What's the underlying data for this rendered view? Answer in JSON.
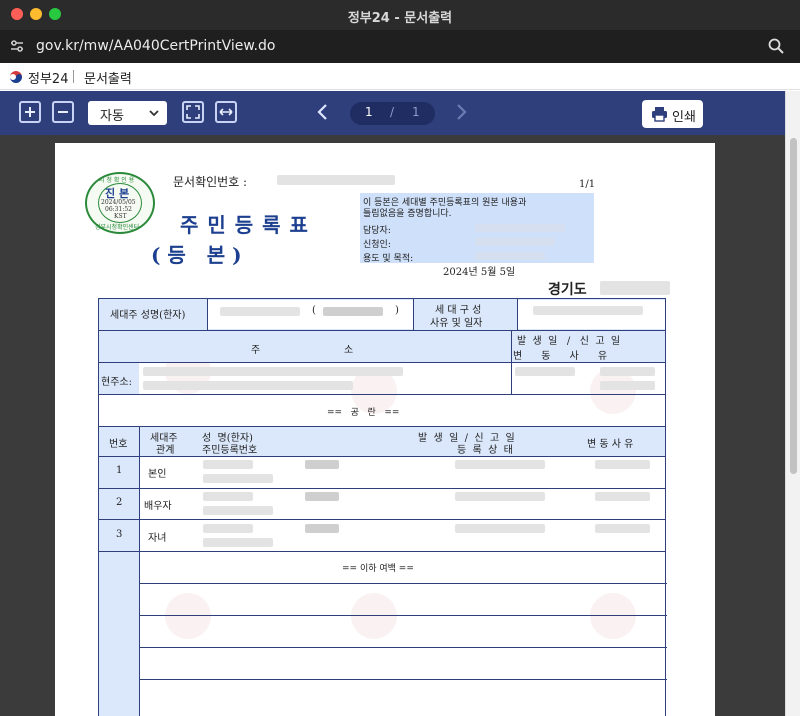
{
  "window": {
    "title": "정부24 - 문서출력"
  },
  "browser": {
    "url": "gov.kr/mw/AA040CertPrintView.do"
  },
  "site": {
    "name": "정부24",
    "page": "문서출력"
  },
  "toolbar": {
    "zoom_value": "자동",
    "page_current": "1",
    "page_separator": "/",
    "page_total": "1",
    "print_label": "인쇄"
  },
  "document": {
    "doc_number_label": "문서확인번호 :",
    "page_label": "1/1",
    "title": "주 민 등 록 표",
    "subtitle": "( 등   본 )",
    "notice_line1": "이 등본은 세대별 주민등록표의 원본 내용과",
    "notice_line2": "틀림없음을 증명합니다.",
    "staff_label": "담당자:",
    "applicant_label": "신청인:",
    "purpose_label": "용도 및 목적:",
    "issue_date": "2024년 5월 5일",
    "region": "경기도",
    "stamp": {
      "top": "시 청 확 인 용",
      "mark": "진 본",
      "date": "2024/05/05",
      "time": "06:31:52",
      "tz": "KST",
      "bottom": "정부시청확인센터"
    },
    "table": {
      "householder_label": "세대주 성명(한자)",
      "household_composition_line1": "세 대 구 성",
      "household_composition_line2": "사유 및 일자",
      "address_col_ju": "주",
      "address_col_so": "소",
      "date_header_line1": "발  생  일   /   신  고  일",
      "date_header_line2": "변      동      사      유",
      "current_address_label": "현주소:",
      "blank_marker": "==   공   란   ==",
      "col_no": "번호",
      "col_relation_line1": "세대주",
      "col_relation_line2": "관계",
      "col_name_line1": "성  명(한자)",
      "col_name_line2": "주민등록번호",
      "col_date_line1": "발  생  일  /  신  고  일",
      "col_date_line2": "등  록  상  태",
      "col_reason": "변 동 사 유",
      "members": [
        {
          "no": "1",
          "relation": "본인"
        },
        {
          "no": "2",
          "relation": "배우자"
        },
        {
          "no": "3",
          "relation": "자녀"
        }
      ],
      "end_marker": "== 이하 여백 =="
    }
  }
}
